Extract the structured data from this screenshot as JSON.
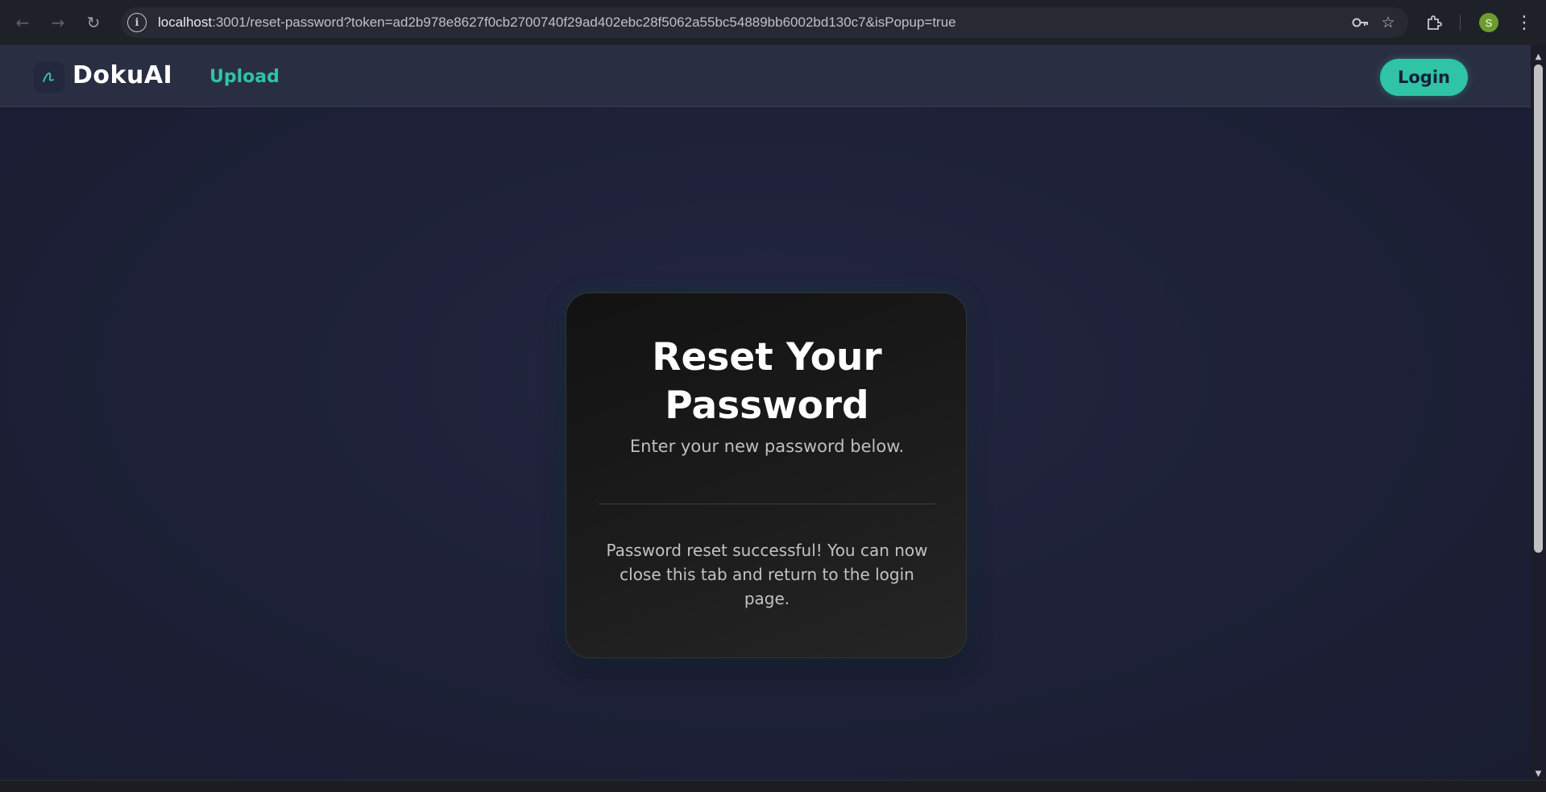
{
  "browser": {
    "url_host": "localhost",
    "url_rest": ":3001/reset-password?token=ad2b978e8627f0cb2700740f29ad402ebc28f5062a55bc54889bb6002bd130c7&isPopup=true",
    "profile_initial": "S",
    "icons": {
      "back": "back-arrow-icon",
      "forward": "forward-arrow-icon",
      "reload": "reload-icon",
      "site_info": "info-icon",
      "password_key": "key-icon",
      "bookmark": "star-icon",
      "extensions": "puzzle-icon",
      "menu": "kebab-menu-icon"
    }
  },
  "header": {
    "brand": "DokuAI",
    "nav_upload": "Upload",
    "login_label": "Login"
  },
  "card": {
    "title": "Reset Your Password",
    "subtitle": "Enter your new password below.",
    "message": "Password reset successful! You can now close this tab and return to the login page."
  },
  "colors": {
    "accent": "#2ec4a5",
    "page_bg": "#1d2036",
    "header_bg": "#2a2e42",
    "card_bg": "#1b1b1b"
  }
}
